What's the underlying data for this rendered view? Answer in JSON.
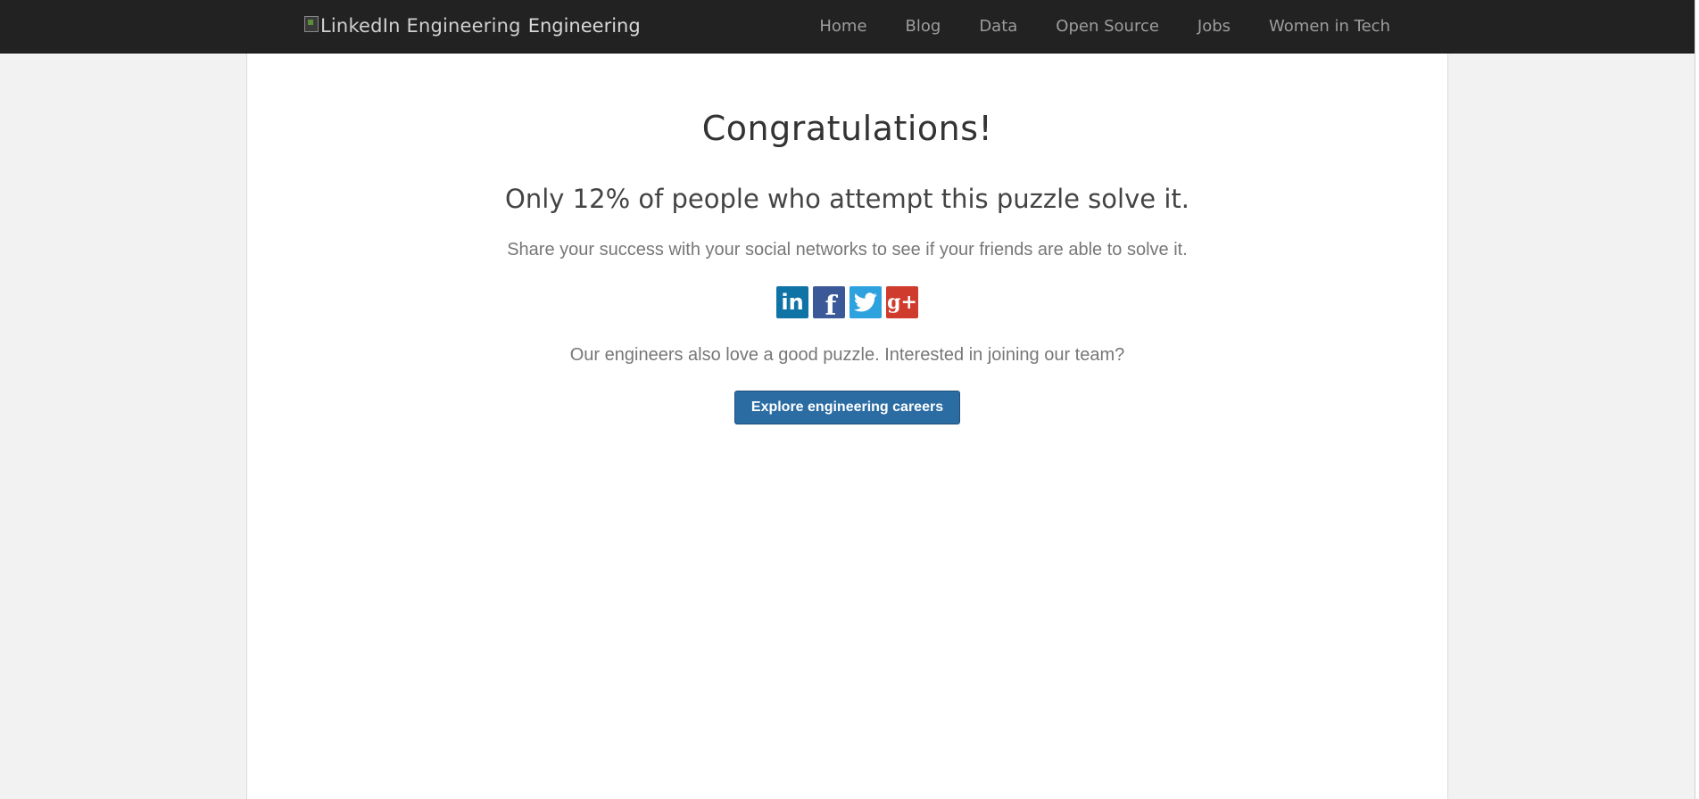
{
  "header": {
    "logo_alt": "LinkedIn Engineering",
    "brand_text": "Engineering",
    "nav": [
      {
        "label": "Home"
      },
      {
        "label": "Blog"
      },
      {
        "label": "Data"
      },
      {
        "label": "Open Source"
      },
      {
        "label": "Jobs"
      },
      {
        "label": "Women in Tech"
      }
    ]
  },
  "main": {
    "title": "Congratulations!",
    "subtitle": "Only 12% of people who attempt this puzzle solve it.",
    "share_text": "Share your success with your social networks to see if your friends are able to solve it.",
    "social": {
      "linkedin_label": "in",
      "facebook_label": "f",
      "google_label": "g+"
    },
    "careers_text": "Our engineers also love a good puzzle. Interested in joining our team?",
    "cta_label": "Explore engineering careers"
  },
  "icons": [
    "broken-image-icon",
    "linkedin-icon",
    "facebook-icon",
    "twitter-icon",
    "google-plus-icon"
  ],
  "colors": {
    "navbar_bg": "#222222",
    "page_bg": "#f2f2f2",
    "cta_bg": "#2b6ca3",
    "linkedin": "#1073a6",
    "facebook": "#3b5998",
    "twitter": "#2ea1df",
    "google": "#cf3b2c"
  }
}
